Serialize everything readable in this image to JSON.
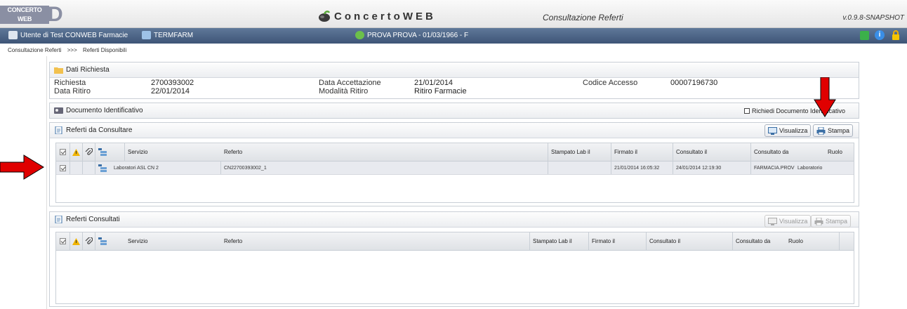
{
  "header": {
    "logo_text_1": "CONCERTO",
    "logo_text_2": "WEB",
    "brand": "ConcertoWEB",
    "app_title": "Consultazione Referti",
    "version": "v.0.9.8-SNAPSHOT"
  },
  "userbar": {
    "user": "Utente di Test CONWEB Farmacie",
    "terminal": "TERMFARM",
    "patient": "PROVA PROVA - 01/03/1966 - F"
  },
  "breadcrumb": {
    "items": [
      "Consultazione Referti",
      ">>>",
      "Referti Disponibili"
    ]
  },
  "dati_richiesta": {
    "title": "Dati Richiesta",
    "richiesta_label": "Richiesta",
    "richiesta_value": "2700393002",
    "data_ritiro_label": "Data Ritiro",
    "data_ritiro_value": "22/01/2014",
    "data_accettazione_label": "Data Accettazione",
    "data_accettazione_value": "21/01/2014",
    "modalita_ritiro_label": "Modalità Ritiro",
    "modalita_ritiro_value": "Ritiro Farmacie",
    "codice_accesso_label": "Codice Accesso",
    "codice_accesso_value": "00007196730"
  },
  "documento": {
    "title": "Documento Identificativo",
    "richiedi_label": "Richiedi Documento Identificativo"
  },
  "referti_da_consultare": {
    "title": "Referti da Consultare",
    "btn_visualizza": "Visualizza",
    "btn_stampa": "Stampa",
    "columns": [
      "Servizio",
      "Referto",
      "Stampato Lab il",
      "Firmato il",
      "Consultato il",
      "Consultato da",
      "Ruolo"
    ],
    "rows": [
      {
        "servizio": "Laboratori ASL CN 2",
        "referto": "CN22700393002_1",
        "stampato": "",
        "firmato": "21/01/2014 16:05:32",
        "consultato": "24/01/2014 12:19:30",
        "consultato_da": "FARMACIA.PROV",
        "ruolo": "Laboratorio"
      }
    ]
  },
  "referti_consultati": {
    "title": "Referti Consultati",
    "btn_visualizza": "Visualizza",
    "btn_stampa": "Stampa",
    "columns": [
      "Servizio",
      "Referto",
      "Stampato Lab il",
      "Firmato il",
      "Consultato il",
      "Consultato da",
      "Ruolo"
    ]
  },
  "colors": {
    "userbar": "#4a6385",
    "annotation_arrow": "#e00000",
    "panel_border": "#c9cfd6"
  }
}
